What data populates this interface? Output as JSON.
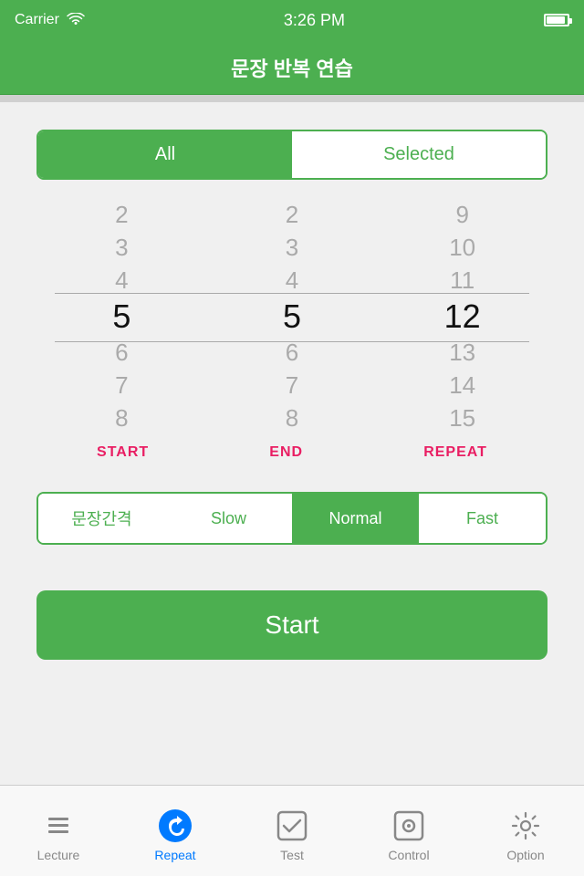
{
  "statusBar": {
    "carrier": "Carrier",
    "time": "3:26 PM"
  },
  "header": {
    "title": "문장 반복 연습"
  },
  "segmented": {
    "all": "All",
    "selected": "Selected",
    "activeTab": "all"
  },
  "picker": {
    "startLabel": "START",
    "endLabel": "END",
    "repeatLabel": "REPEAT",
    "startColumn": [
      "2",
      "3",
      "4",
      "5",
      "6",
      "7",
      "8"
    ],
    "endColumn": [
      "2",
      "3",
      "4",
      "5",
      "6",
      "7",
      "8"
    ],
    "repeatColumn": [
      "9",
      "10",
      "11",
      "12",
      "13",
      "14",
      "15"
    ],
    "startSelected": "5",
    "endSelected": "5",
    "repeatSelected": "12"
  },
  "speed": {
    "label1": "문장간격",
    "label2": "Slow",
    "label3": "Normal",
    "label4": "Fast",
    "active": "Normal"
  },
  "startButton": {
    "label": "Start"
  },
  "tabs": [
    {
      "id": "lecture",
      "label": "Lecture",
      "icon": "list-icon",
      "active": false
    },
    {
      "id": "repeat",
      "label": "Repeat",
      "icon": "repeat-icon",
      "active": true
    },
    {
      "id": "test",
      "label": "Test",
      "icon": "check-icon",
      "active": false
    },
    {
      "id": "control",
      "label": "Control",
      "icon": "control-icon",
      "active": false
    },
    {
      "id": "option",
      "label": "Option",
      "icon": "gear-icon",
      "active": false
    }
  ]
}
